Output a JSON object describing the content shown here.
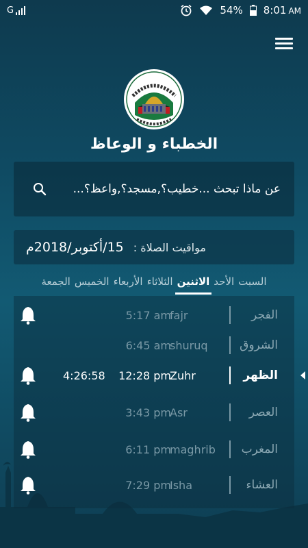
{
  "status": {
    "network": "G",
    "battery": "54%",
    "time": "8:01",
    "ampm": "AM"
  },
  "app": {
    "title": "الخطباء و الوعاظ"
  },
  "search": {
    "placeholder": "عن ماذا تبحث ...خطيب؟,مسجد؟,واعظ؟..."
  },
  "date": {
    "label": "مواقيت الصلاة :",
    "value": "15/أكتوبر/2018م"
  },
  "days": [
    {
      "label": "السبت",
      "active": false
    },
    {
      "label": "الأحد",
      "active": false
    },
    {
      "label": "الاثنين",
      "active": true
    },
    {
      "label": "الثلاثاء",
      "active": false
    },
    {
      "label": "الأربعاء",
      "active": false
    },
    {
      "label": "الخميس",
      "active": false
    },
    {
      "label": "الجمعة",
      "active": false
    }
  ],
  "prayers": [
    {
      "ar": "الفجر",
      "en": "fajr",
      "time": "5:17 am",
      "countdown": ""
    },
    {
      "ar": "الشروق",
      "en": "shuruq",
      "time": "6:45 am",
      "countdown": ""
    },
    {
      "ar": "الظهر",
      "en": "Zuhr",
      "time": "12:28 pm",
      "countdown": "4:26:58"
    },
    {
      "ar": "العصر",
      "en": "Asr",
      "time": "3:43 pm",
      "countdown": ""
    },
    {
      "ar": "المغرب",
      "en": "maghrib",
      "time": "6:11 pm",
      "countdown": ""
    },
    {
      "ar": "العشاء",
      "en": "Isha",
      "time": "7:29 pm",
      "countdown": ""
    }
  ],
  "active_prayer_index": 2,
  "icons": {
    "menu": "menu-icon",
    "search": "search-icon",
    "bell": "bell-icon",
    "logo": "ministry-logo"
  },
  "colors": {
    "active_text": "#ffffff",
    "inactive_text": "#7a99a6"
  }
}
